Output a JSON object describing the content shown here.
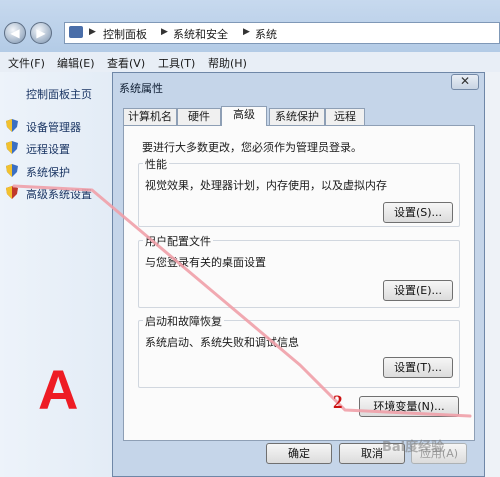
{
  "addressbar": {
    "crumbs": [
      "控制面板",
      "系统和安全",
      "系统"
    ]
  },
  "menubar": {
    "items": [
      "文件(F)",
      "编辑(E)",
      "查看(V)",
      "工具(T)",
      "帮助(H)"
    ]
  },
  "leftpane": {
    "home": "控制面板主页",
    "items": [
      "设备管理器",
      "远程设置",
      "系统保护",
      "高级系统设置"
    ]
  },
  "dialog": {
    "title": "系统属性",
    "tabs": [
      "计算机名",
      "硬件",
      "高级",
      "系统保护",
      "远程"
    ],
    "active_tab": "高级",
    "intro": "要进行大多数更改，您必须作为管理员登录。",
    "groups": [
      {
        "title": "性能",
        "desc": "视觉效果，处理器计划，内存使用，以及虚拟内存",
        "button": "设置(S)..."
      },
      {
        "title": "用户配置文件",
        "desc": "与您登录有关的桌面设置",
        "button": "设置(E)..."
      },
      {
        "title": "启动和故障恢复",
        "desc": "系统启动、系统失败和调试信息",
        "button": "设置(T)..."
      }
    ],
    "env_button": "环境变量(N)...",
    "footer": {
      "ok": "确定",
      "cancel": "取消",
      "apply": "应用(A)"
    }
  },
  "annotations": {
    "letter": "A",
    "step": "2",
    "watermark": "Bai度经验",
    "color": "#ee1c24"
  }
}
